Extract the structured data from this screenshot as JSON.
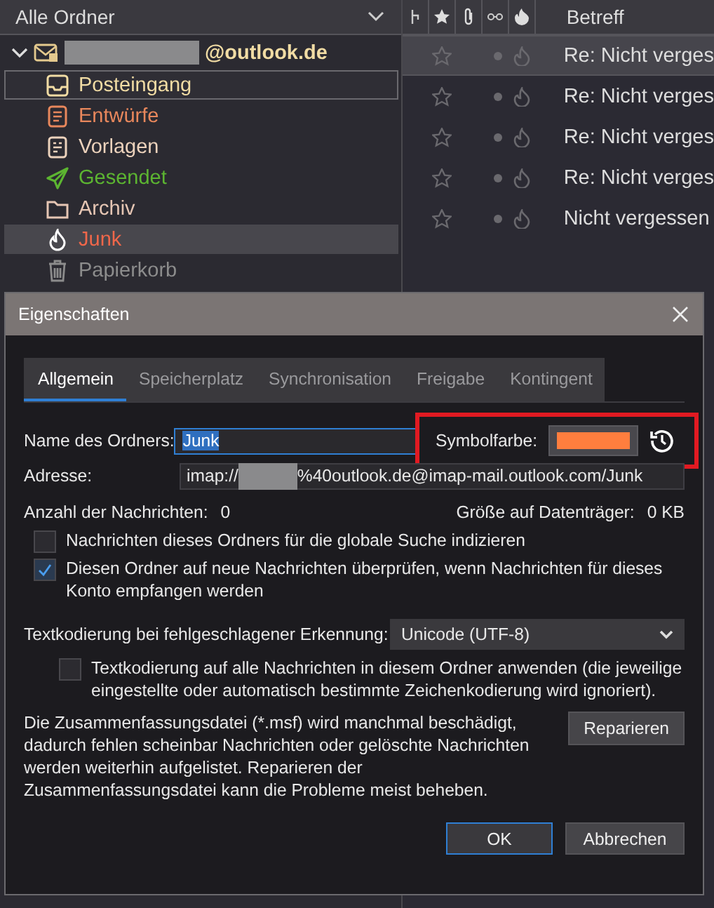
{
  "folder_pane": {
    "header": "Alle Ordner",
    "account": {
      "name_suffix": "@outlook.de",
      "expanded": true
    },
    "folders": [
      {
        "kind": "inbox",
        "label": "Posteingang",
        "color": "#f1dca4",
        "selected": false,
        "focused": true
      },
      {
        "kind": "drafts",
        "label": "Entwürfe",
        "color": "#e8875c",
        "selected": false,
        "focused": false
      },
      {
        "kind": "templates",
        "label": "Vorlagen",
        "color": "#ecd2bc",
        "selected": false,
        "focused": false
      },
      {
        "kind": "sent",
        "label": "Gesendet",
        "color": "#5cb531",
        "selected": false,
        "focused": false
      },
      {
        "kind": "archive",
        "label": "Archiv",
        "color": "#e6c6b4",
        "selected": false,
        "focused": false
      },
      {
        "kind": "junk",
        "label": "Junk",
        "color": "#f0674a",
        "selected": true,
        "focused": false
      },
      {
        "kind": "trash",
        "label": "Papierkorb",
        "color": "#8c8c8c",
        "selected": false,
        "focused": false
      }
    ]
  },
  "message_list": {
    "subject_header": "Betreff",
    "rows": [
      {
        "subject": "Re: Nicht verges",
        "starred": false,
        "selected": true
      },
      {
        "subject": "Re: Nicht verges",
        "starred": false,
        "selected": false
      },
      {
        "subject": "Re: Nicht verges",
        "starred": false,
        "selected": false
      },
      {
        "subject": "Re: Nicht verges",
        "starred": false,
        "selected": false
      },
      {
        "subject": "Nicht vergessen",
        "starred": false,
        "selected": false
      }
    ]
  },
  "dialog": {
    "title": "Eigenschaften",
    "tabs": [
      {
        "label": "Allgemein",
        "selected": true
      },
      {
        "label": "Speicherplatz",
        "selected": false
      },
      {
        "label": "Synchronisation",
        "selected": false
      },
      {
        "label": "Freigabe",
        "selected": false
      },
      {
        "label": "Kontingent",
        "selected": false
      }
    ],
    "name_label": "Name des Ordners:",
    "name_value": "Junk",
    "symbol_color": {
      "label": "Symbolfarbe:",
      "color": "#ff7e3e",
      "highlighted": true
    },
    "address_label": "Adresse:",
    "address_prefix": "imap://",
    "address_suffix": "%40outlook.de@imap-mail.outlook.com/Junk",
    "message_count_label": "Anzahl der Nachrichten:",
    "message_count": "0",
    "size_label": "Größe auf Datenträger:",
    "size": "0 KB",
    "checkboxes": [
      {
        "label": "Nachrichten dieses Ordners für die globale Suche indizieren",
        "checked": false
      },
      {
        "label": "Diesen Ordner auf neue Nachrichten überprüfen, wenn Nachrichten für dieses Konto empfangen werden",
        "checked": true
      }
    ],
    "encoding_label": "Textkodierung bei fehlgeschlagener Erkennung:",
    "encoding_value": "Unicode (UTF-8)",
    "encoding_checkbox": {
      "label": "Textkodierung auf alle Nachrichten in diesem Ordner anwenden (die jeweilige eingestellte oder automatisch bestimmte Zeichenkodierung wird ignoriert).",
      "checked": false
    },
    "repair_text": "Die Zusammenfassungsdatei (*.msf) wird manchmal beschädigt, dadurch fehlen scheinbar Nachrichten oder gelöschte Nachrichten werden weiterhin aufgelistet. Reparieren der Zusammenfassungsdatei kann die Probleme meist beheben.",
    "repair_button": "Reparieren",
    "buttons": [
      {
        "label": "OK",
        "kind": "primary"
      },
      {
        "label": "Abbrechen",
        "kind": "secondary"
      }
    ]
  }
}
